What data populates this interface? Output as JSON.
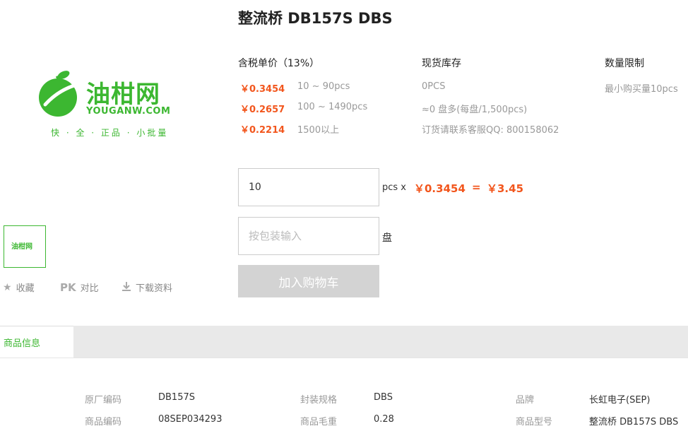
{
  "product": {
    "title": "整流桥 DB157S DBS"
  },
  "logo": {
    "brand_text": "油柑网",
    "url_text": "YOUGANW.COM",
    "slogan": "快 · 全 · 正品 · 小批量",
    "thumb_text": "油柑网"
  },
  "pricing": {
    "header": "含税单价（13%）",
    "tiers": [
      {
        "price": "￥0.3454",
        "range": "10 ~ 90pcs"
      },
      {
        "price": "￥0.2657",
        "range": "100 ~ 1490pcs"
      },
      {
        "price": "￥0.2214",
        "range": "1500以上"
      }
    ]
  },
  "stock": {
    "header": "现货库存",
    "lines": [
      "0PCS",
      "≈0 盘多(每盘/1,500pcs)",
      "订货请联系客服QQ: 800158062"
    ]
  },
  "limit": {
    "header": "数量限制",
    "text": "最小购买量10pcs"
  },
  "order": {
    "quantity": "10",
    "unit_label": "pcs x",
    "unit_price": "￥0.3454",
    "equals": "=",
    "total": "￥3.45",
    "pack_placeholder": "按包装输入",
    "pack_unit": "盘",
    "cart_button": "加入购物车"
  },
  "actions": {
    "favorite": "收藏",
    "compare_icon": "PK",
    "compare": "对比",
    "download": "下载资料"
  },
  "tabs": {
    "active": "商品信息"
  },
  "specs": [
    {
      "label": "原厂编码",
      "value": "DB157S"
    },
    {
      "label": "封装规格",
      "value": "DBS"
    },
    {
      "label": "品牌",
      "value": "长虹电子(SEP)"
    },
    {
      "label": "商品编码",
      "value": "08SEP034293"
    },
    {
      "label": "商品毛重",
      "value": "0.28"
    },
    {
      "label": "商品型号",
      "value": "整流桥 DB157S DBS"
    }
  ],
  "colors": {
    "accent_green": "#3cb731",
    "price_orange": "#f2561d",
    "button_gray": "#d3d3d3"
  },
  "icons": {
    "favorite": "star-icon",
    "download": "download-icon",
    "logo": "fruit-logo-icon"
  }
}
